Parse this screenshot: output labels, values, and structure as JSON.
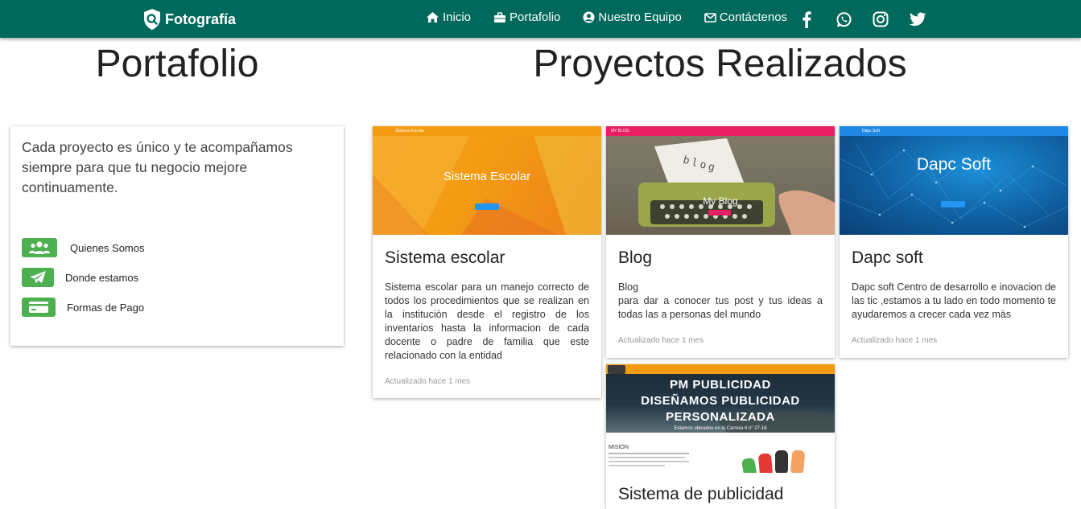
{
  "navbar": {
    "brand": "Fotografía",
    "links": [
      {
        "label": "Inicio",
        "icon": "home-icon"
      },
      {
        "label": "Portafolio",
        "icon": "briefcase-icon"
      },
      {
        "label": "Nuestro Equipo",
        "icon": "user-circle-icon"
      },
      {
        "label": "Contáctenos",
        "icon": "envelope-icon"
      }
    ],
    "social": [
      "facebook-icon",
      "whatsapp-icon",
      "instagram-icon",
      "twitter-icon"
    ]
  },
  "headings": {
    "left": "Portafolio",
    "right": "Proyectos Realizados"
  },
  "info_card": {
    "text": "Cada proyecto es único y te acompañamos siempre para que tu negocio mejore continuamente.",
    "items": [
      {
        "label": "Quienes Somos",
        "icon": "users-icon"
      },
      {
        "label": "Donde estamos",
        "icon": "paper-plane-icon"
      },
      {
        "label": "Formas de Pago",
        "icon": "credit-card-icon"
      }
    ]
  },
  "projects": [
    {
      "title": "Sistema escolar",
      "description": "Sistema escolar para un manejo correcto de todos los procedimientos que se realizan en la instituciòn desde el registro de los inventarios hasta la informacion de cada docente o padre de familia que este relacionado con la entidad",
      "updated": "Actualizado hace 1 mes",
      "thumb": {
        "heading": "Sistema Escolar",
        "nav_brand": "Sistema Escolar"
      }
    },
    {
      "title": "Blog",
      "description_line1": "Blog",
      "description": "para dar a conocer tus post y tus ideas a todas las a personas del mundo",
      "updated": "Actualizado hace 1 mes",
      "thumb": {
        "heading": "My Blog",
        "nav_brand": "MY BLOG",
        "paper_text": "blog"
      }
    },
    {
      "title": "Dapc soft",
      "description": "Dapc soft Centro de desarrollo e inovacion de las tic ,estamos a tu lado en todo momento te ayudaremos a crecer cada vez màs",
      "updated": "Actualizado hace 1 mes",
      "thumb": {
        "heading": "Dapc Soft",
        "nav_brand": "Dapc Soft"
      }
    },
    {
      "title": "Sistema de publicidad",
      "thumb": {
        "line1": "PM PUBLICIDAD",
        "line2": "DISEÑAMOS PUBLICIDAD",
        "line3": "PERSONALIZADA",
        "line4": "Estamos ubicados en la Carrera 4 n° 27-16",
        "section": "MISION"
      }
    }
  ],
  "colors": {
    "navbar": "#00695c",
    "accent_green": "#4caf50",
    "escolar_orange": "#f39c12",
    "blog_pink": "#e91e63",
    "dapc_blue": "#1e88e5"
  }
}
